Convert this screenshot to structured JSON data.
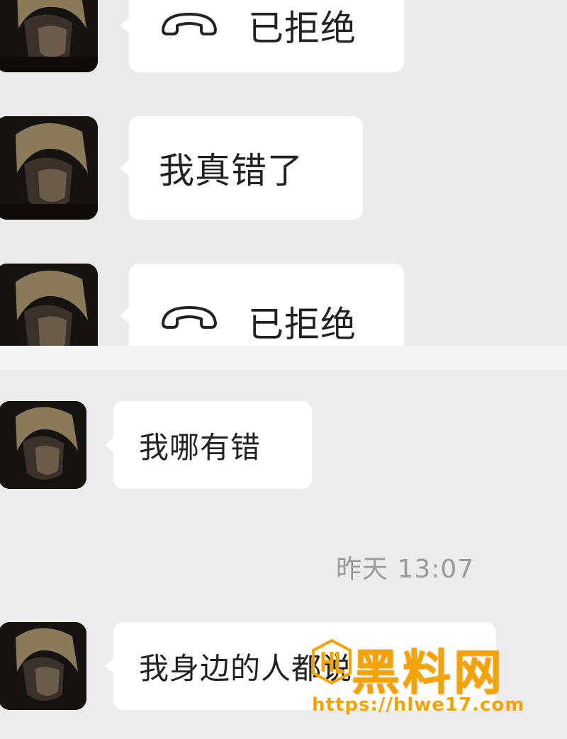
{
  "messages": {
    "m1": {
      "icon": "phone-hangup-icon",
      "text": "已拒绝"
    },
    "m2": {
      "text": "我真错了"
    },
    "m3": {
      "icon": "phone-hangup-icon",
      "text": "已拒绝"
    },
    "m4": {
      "text": "我哪有错"
    },
    "m5": {
      "text": "我身边的人都说"
    }
  },
  "timestamp": "昨天 13:07",
  "watermark": {
    "title": "黑料网",
    "url": "https://hlwe17.com"
  },
  "colors": {
    "bubble": "#ffffff",
    "background": "#ececec",
    "timestamp": "#9a9a9a",
    "watermark": "#f5a300"
  }
}
